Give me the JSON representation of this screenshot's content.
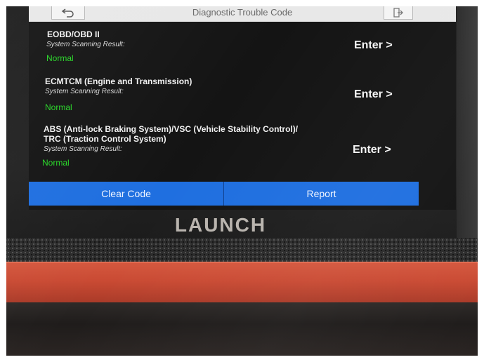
{
  "header": {
    "title": "Diagnostic Trouble Code",
    "back_icon": "back-arrow-icon",
    "exit_icon": "exit-icon"
  },
  "systems": [
    {
      "title_lines": [
        "EOBD/OBD II"
      ],
      "result_label": "System Scanning Result:",
      "status": "Normal",
      "enter_label": "Enter >"
    },
    {
      "title_lines": [
        "ECMTCM (Engine and Transmission)"
      ],
      "result_label": "System Scanning Result:",
      "status": "Normal",
      "enter_label": "Enter >"
    },
    {
      "title_lines": [
        "ABS (Anti-lock Braking System)/VSC (Vehicle Stability Control)/",
        "TRC (Traction Control System)"
      ],
      "result_label": "System Scanning Result:",
      "status": "Normal",
      "enter_label": "Enter >"
    }
  ],
  "actions": {
    "clear_code": "Clear Code",
    "report": "Report"
  },
  "device": {
    "brand": "LAUNCH"
  },
  "colors": {
    "status_ok": "#27d627",
    "button_bar": "#1f6fe0",
    "screen_bg": "#141414",
    "bumper": "#c94a33"
  }
}
